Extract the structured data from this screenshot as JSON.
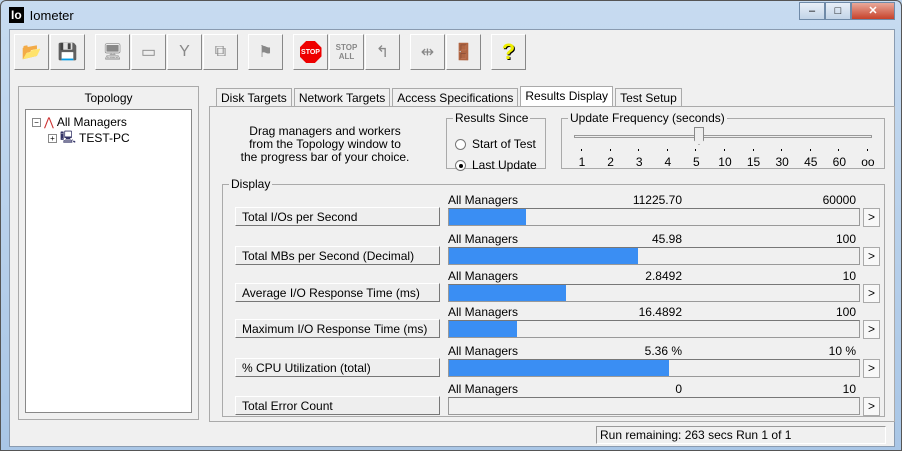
{
  "window": {
    "title": "Iometer",
    "logo": "Io",
    "minimize": "–",
    "maximize": "□",
    "close": "✕"
  },
  "toolbar": [
    {
      "name": "open-icon",
      "glyph": "📂"
    },
    {
      "name": "save-icon",
      "glyph": "💾"
    },
    {
      "name": "start-manager-icon",
      "glyph": "🖥"
    },
    {
      "name": "new-worker-icon",
      "glyph": "▭"
    },
    {
      "name": "new-network-worker-icon",
      "glyph": "Y"
    },
    {
      "name": "copy-worker-icon",
      "glyph": "⧉"
    },
    {
      "name": "start-tests-icon",
      "glyph": "⚑"
    },
    {
      "name": "stop-icon",
      "glyph": "STOP"
    },
    {
      "name": "stop-all-icon",
      "glyph": "STOP ALL"
    },
    {
      "name": "reset-workers-icon",
      "glyph": "↰"
    },
    {
      "name": "disconnect-icon",
      "glyph": "⇹"
    },
    {
      "name": "exit-icon",
      "glyph": "🚪"
    },
    {
      "name": "help-icon",
      "glyph": "?"
    }
  ],
  "topology": {
    "header": "Topology",
    "root": "All Managers",
    "child": "TEST-PC"
  },
  "tabs": [
    "Disk Targets",
    "Network Targets",
    "Access Specifications",
    "Results Display",
    "Test Setup"
  ],
  "help_text": "Drag managers and workers from the Topology window to the progress bar of your choice.",
  "results_since": {
    "label": "Results Since",
    "options": [
      "Start of Test",
      "Last Update"
    ],
    "selected": 1
  },
  "update_frequency": {
    "label": "Update Frequency (seconds)",
    "ticks": [
      "1",
      "2",
      "3",
      "4",
      "5",
      "10",
      "15",
      "30",
      "45",
      "60",
      "oo"
    ],
    "selected": "5"
  },
  "display": {
    "label": "Display",
    "rows": [
      {
        "button": "Total I/Os per Second",
        "source": "All Managers",
        "value": "11225.70",
        "max": "60000",
        "fraction": 0.187
      },
      {
        "button": "Total MBs per Second (Decimal)",
        "source": "All Managers",
        "value": "45.98",
        "max": "100",
        "fraction": 0.4598
      },
      {
        "button": "Average I/O Response Time (ms)",
        "source": "All Managers",
        "value": "2.8492",
        "max": "10",
        "fraction": 0.285
      },
      {
        "button": "Maximum I/O Response Time (ms)",
        "source": "All Managers",
        "value": "16.4892",
        "max": "100",
        "fraction": 0.165
      },
      {
        "button": "% CPU Utilization (total)",
        "source": "All Managers",
        "value": "5.36 %",
        "max": "10 %",
        "fraction": 0.536
      },
      {
        "button": "Total Error Count",
        "source": "All Managers",
        "value": "0",
        "max": "10",
        "fraction": 0
      }
    ],
    "arrow": ">"
  },
  "status": "Run remaining: 263 secs  Run 1 of 1",
  "colors": {
    "bar": "#3a8ef3"
  }
}
